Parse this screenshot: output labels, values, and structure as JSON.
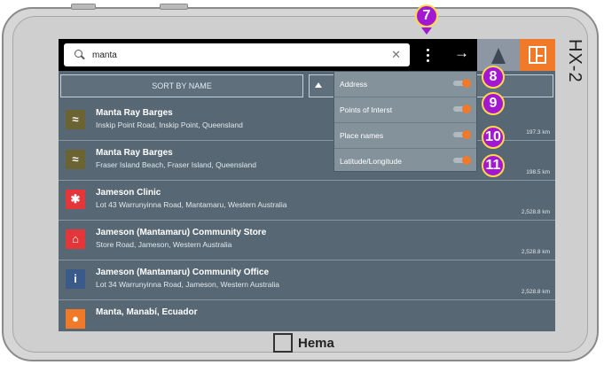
{
  "device": {
    "model": "HX-2",
    "brand": "Hema"
  },
  "search": {
    "query": "manta",
    "clear_icon": "✕"
  },
  "header": {
    "forward_icon": "→"
  },
  "sort": {
    "label": "SORT BY NAME"
  },
  "results": [
    {
      "title": "Manta Ray Barges",
      "sub": "Inskip Point Road, Inskip Point, Queensland",
      "distance": "197.3 km",
      "icon": "water-icon",
      "glyph": "≈",
      "color": "#6b6331"
    },
    {
      "title": "Manta Ray Barges",
      "sub": "Fraser Island Beach, Fraser Island, Queensland",
      "distance": "198.5 km",
      "icon": "water-icon",
      "glyph": "≈",
      "color": "#6b6331"
    },
    {
      "title": "Jameson Clinic",
      "sub": "Lot 43 Warrunyinna Road, Mantamaru, Western Australia",
      "distance": "2,528.8 km",
      "icon": "medical-icon",
      "glyph": "✱",
      "color": "#e2363b"
    },
    {
      "title": "Jameson (Mantamaru) Community Store",
      "sub": "Store Road, Jameson, Western Australia",
      "distance": "2,528.8 km",
      "icon": "store-icon",
      "glyph": "⌂",
      "color": "#e2363b"
    },
    {
      "title": "Jameson (Mantamaru) Community Office",
      "sub": "Lot 34 Warrunyinna Road, Jameson, Western Australia",
      "distance": "2,528.8 km",
      "icon": "info-icon",
      "glyph": "i",
      "color": "#3a5a8a"
    },
    {
      "title": "Manta, Manabí, Ecuador",
      "sub": "",
      "distance": "",
      "icon": "location-pin-icon",
      "glyph": "●",
      "color": "#f07a2a"
    }
  ],
  "filters": [
    {
      "label": "Address",
      "enabled": true
    },
    {
      "label": "Points of Interst",
      "enabled": true
    },
    {
      "label": "Place names",
      "enabled": true
    },
    {
      "label": "Latitude/Longitude",
      "enabled": true
    }
  ],
  "callouts": [
    "7",
    "8",
    "9",
    "10",
    "11"
  ]
}
